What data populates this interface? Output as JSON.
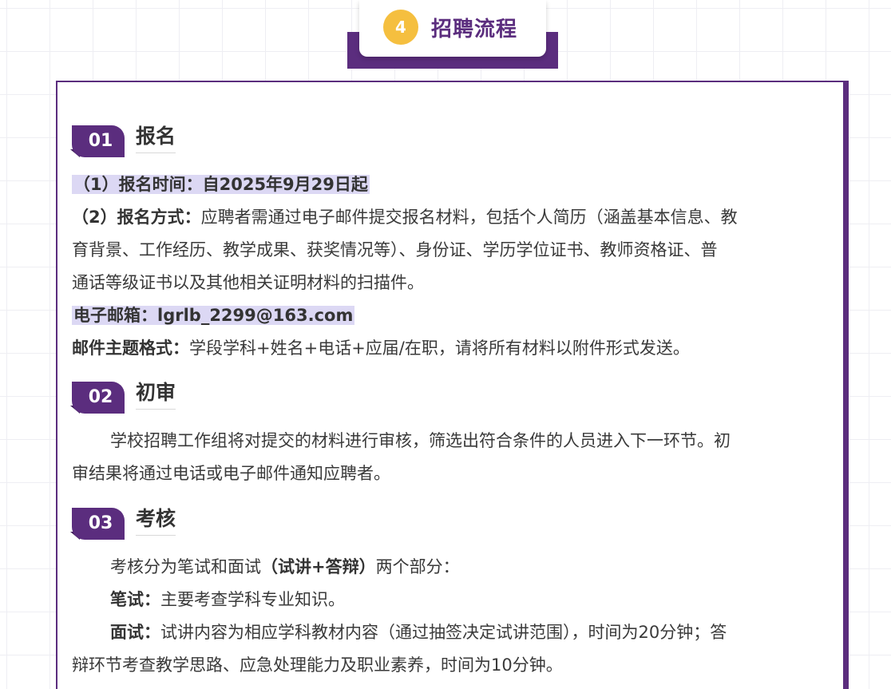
{
  "header": {
    "step_number": "4",
    "title": "招聘流程"
  },
  "sections": [
    {
      "number": "01",
      "title": "报名",
      "time_line": "（1）报名时间：自2025年9月29日起",
      "method_label": "（2）报名方式：",
      "method_line1": "应聘者需通过电子邮件提交报名材料，包括个人简历（涵盖基本信息、教",
      "method_line2": "育背景、工作经历、教学成果、获奖情况等）、身份证、学历学位证书、教师资格证、普",
      "method_line3": "通话等级证书以及其他相关证明材料的扫描件。",
      "email_line": "电子邮箱：lgrlb_2299@163.com",
      "subject_label": "邮件主题格式：",
      "subject_text": "学段学科+姓名+电话+应届/在职，请将所有材料以附件形式发送。"
    },
    {
      "number": "02",
      "title": "初审",
      "line1": "学校招聘工作组将对提交的材料进行审核，筛选出符合条件的人员进入下一环节。初",
      "line2": "审结果将通过电话或电子邮件通知应聘者。"
    },
    {
      "number": "03",
      "title": "考核",
      "intro_pre": "考核分为笔试和面试",
      "intro_bold": "（试讲+答辩）",
      "intro_post": "两个部分：",
      "written_label": "笔试：",
      "written_text": "主要考查学科专业知识。",
      "interview_label": "面试：",
      "interview_line1": "试讲内容为相应学科教材内容（通过抽签决定试讲范围），时间为20分钟；答",
      "interview_line2": "辩环节考查教学思路、应急处理能力及职业素养，时间为10分钟。"
    }
  ]
}
